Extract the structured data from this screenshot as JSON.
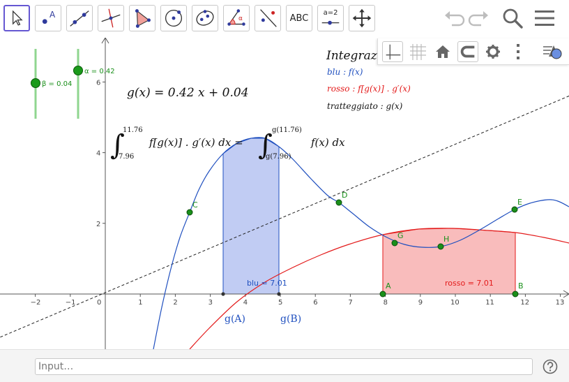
{
  "toolbar": {
    "tools": [
      {
        "name": "move-tool",
        "icon": "cursor-arrow-icon",
        "active": true
      },
      {
        "name": "point-tool",
        "icon": "point-icon",
        "label": "A"
      },
      {
        "name": "line-tool",
        "icon": "line-through-two-points-icon"
      },
      {
        "name": "perpendicular-line-tool",
        "icon": "perpendicular-line-icon"
      },
      {
        "name": "polygon-tool",
        "icon": "polygon-icon"
      },
      {
        "name": "circle-tool",
        "icon": "circle-with-center-icon"
      },
      {
        "name": "ellipse-tool",
        "icon": "ellipse-icon"
      },
      {
        "name": "angle-tool",
        "icon": "angle-icon",
        "label": "α"
      },
      {
        "name": "reflect-tool",
        "icon": "reflect-about-line-icon"
      },
      {
        "name": "text-tool",
        "icon": "text-icon",
        "label": "ABC"
      },
      {
        "name": "slider-tool",
        "icon": "slider-icon",
        "label": "a=2"
      },
      {
        "name": "move-graphics-view-tool",
        "icon": "move-arrows-icon"
      }
    ],
    "right": [
      {
        "name": "undo-button",
        "icon": "undo-icon"
      },
      {
        "name": "redo-button",
        "icon": "redo-icon"
      },
      {
        "name": "search-button",
        "icon": "search-icon"
      },
      {
        "name": "main-menu-button",
        "icon": "hamburger-menu-icon"
      }
    ]
  },
  "stylebar": {
    "buttons": [
      {
        "name": "show-axes-button",
        "icon": "axes-icon",
        "active": true
      },
      {
        "name": "show-grid-button",
        "icon": "grid-icon"
      },
      {
        "name": "standard-view-button",
        "icon": "home-icon"
      },
      {
        "name": "point-capturing-button",
        "icon": "magnet-icon"
      },
      {
        "name": "graphics-settings-button",
        "icon": "gear-icon"
      },
      {
        "name": "more-options-button",
        "icon": "vertical-dots-icon"
      },
      {
        "name": "toggle-style-bar-button",
        "icon": "style-bar-triangle-icon"
      }
    ]
  },
  "sliders": [
    {
      "name": "beta",
      "label": "β = 0.04",
      "value": 0.04
    },
    {
      "name": "alpha",
      "label": "α = 0.42",
      "value": 0.42
    }
  ],
  "texts": {
    "g_definition": "g(x) = 0.42 x + 0.04",
    "title": "Integraz",
    "legend_blue": "blu : f(x)",
    "legend_red": "rosso : f[g(x)] . g′(x)",
    "legend_dashed": "tratteggiato : g(x)",
    "integral_lhs_upper": "11.76",
    "integral_lhs_lower": "7.96",
    "integral_lhs_integrand": "f[g(x)] . g′(x) dx =",
    "integral_rhs_upper": "g(11.76)",
    "integral_rhs_lower": "g(7.96)",
    "integral_rhs_integrand": "f(x) dx",
    "ga_label": "g(A)",
    "gb_label": "g(B)",
    "blu_area": "blu = 7.01",
    "rosso_area": "rosso = 7.01"
  },
  "points": [
    {
      "name": "A",
      "label": "A"
    },
    {
      "name": "B",
      "label": "B"
    },
    {
      "name": "C",
      "label": "C"
    },
    {
      "name": "D",
      "label": "D"
    },
    {
      "name": "E",
      "label": "E"
    },
    {
      "name": "G",
      "label": "G"
    },
    {
      "name": "H",
      "label": "H"
    }
  ],
  "axes": {
    "x_ticks": [
      "−2",
      "−1",
      "0",
      "1",
      "2",
      "3",
      "4",
      "5",
      "6",
      "7",
      "8",
      "9",
      "10",
      "11",
      "12",
      "13"
    ],
    "y_ticks": [
      "2",
      "4",
      "6"
    ]
  },
  "colors": {
    "blue_curve": "#1f4fbf",
    "red_curve": "#e31a1a",
    "blue_fill": "#9fb0ec",
    "red_fill": "#f7a6a6",
    "point": "#1a8f1a",
    "slider_track": "#8fd68f",
    "slider_knob": "#1a9a1a",
    "active_tool": "#6557d2"
  },
  "input": {
    "placeholder": "Input…",
    "value": ""
  }
}
